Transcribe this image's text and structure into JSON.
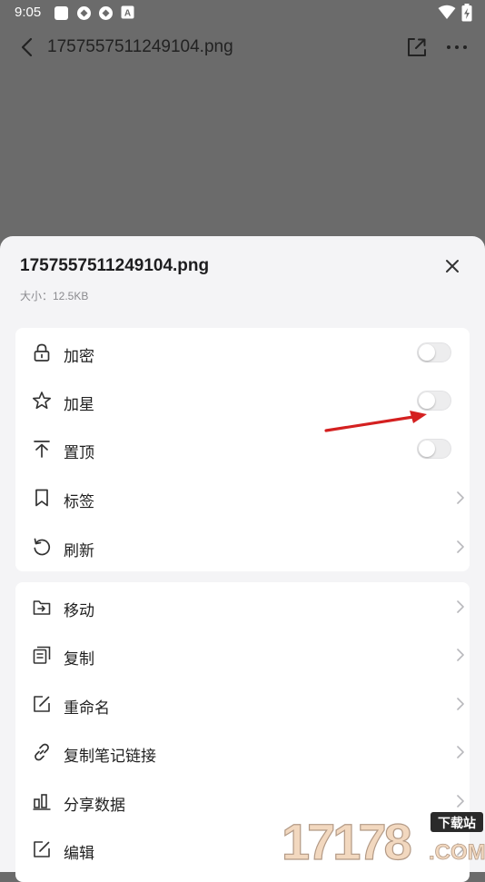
{
  "status_bar": {
    "time": "9:05",
    "notif_badge": "A"
  },
  "top_bar": {
    "title": "1757557511249104.png"
  },
  "sheet": {
    "title": "1757557511249104.png",
    "size_line": "大小：12.5KB"
  },
  "group1": [
    {
      "label": "加密",
      "icon": "lock-icon",
      "control": "toggle",
      "on": false
    },
    {
      "label": "加星",
      "icon": "star-icon",
      "control": "toggle",
      "on": false
    },
    {
      "label": "置顶",
      "icon": "pin-top-icon",
      "control": "toggle",
      "on": false
    },
    {
      "label": "标签",
      "icon": "bookmark-icon",
      "control": "chevron"
    },
    {
      "label": "刷新",
      "icon": "refresh-icon",
      "control": "chevron"
    }
  ],
  "group2": [
    {
      "label": "移动",
      "icon": "move-icon",
      "control": "chevron"
    },
    {
      "label": "复制",
      "icon": "copy-icon",
      "control": "chevron"
    },
    {
      "label": "重命名",
      "icon": "rename-icon",
      "control": "chevron"
    },
    {
      "label": "复制笔记链接",
      "icon": "link-icon",
      "control": "chevron"
    },
    {
      "label": "分享数据",
      "icon": "chart-icon",
      "control": "chevron"
    },
    {
      "label": "编辑",
      "icon": "edit-icon",
      "control": "chevron"
    }
  ],
  "watermark": {
    "number": "17178",
    "badge": "下载站",
    "suffix": ".COM"
  },
  "colors": {
    "overlay": "#6b6b6b",
    "sheet_bg": "#f4f4f6",
    "card_bg": "#ffffff",
    "annotation_arrow": "#d42020"
  }
}
